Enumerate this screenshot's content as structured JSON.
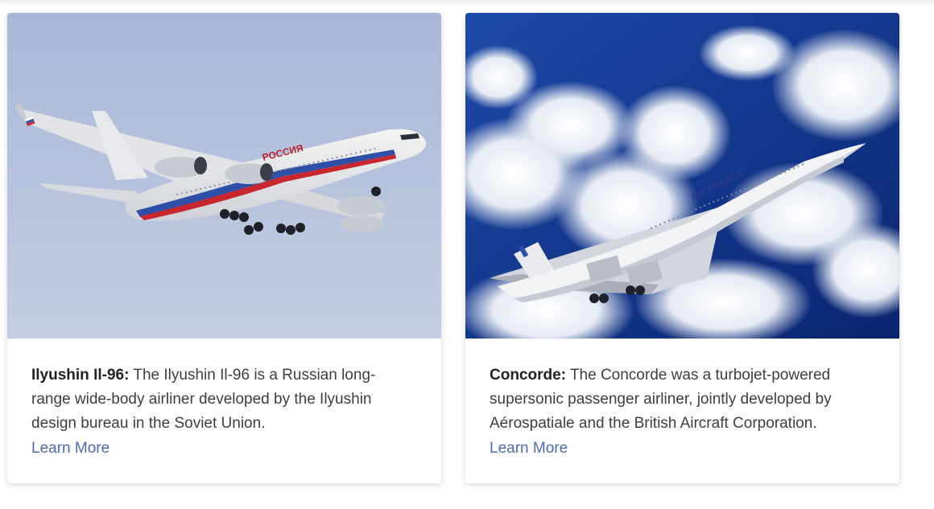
{
  "cards": [
    {
      "name": "Ilyushin Il-96:",
      "description": "The Ilyushin Il-96 is a Russian long-range wide-body airliner developed by the Ilyushin design bureau in the Soviet Union.",
      "link_label": "Learn More",
      "image": {
        "subject": "Russian Il-96 airliner in flight",
        "livery_text": "РОССИЯ",
        "sky_color": "#b7c3dd"
      }
    },
    {
      "name": "Concorde:",
      "description": "The Concorde was a turbojet-powered supersonic passenger airliner, jointly developed by Aérospatiale and the British Aircraft Corporation.",
      "link_label": "Learn More",
      "image": {
        "subject": "Air France Concorde climbing through clouds",
        "livery_text": "AIR FRANCE",
        "sky_color": "#0d2e7a"
      }
    }
  ],
  "colors": {
    "link": "#4a6bb5",
    "text": "#3e3e3e"
  }
}
